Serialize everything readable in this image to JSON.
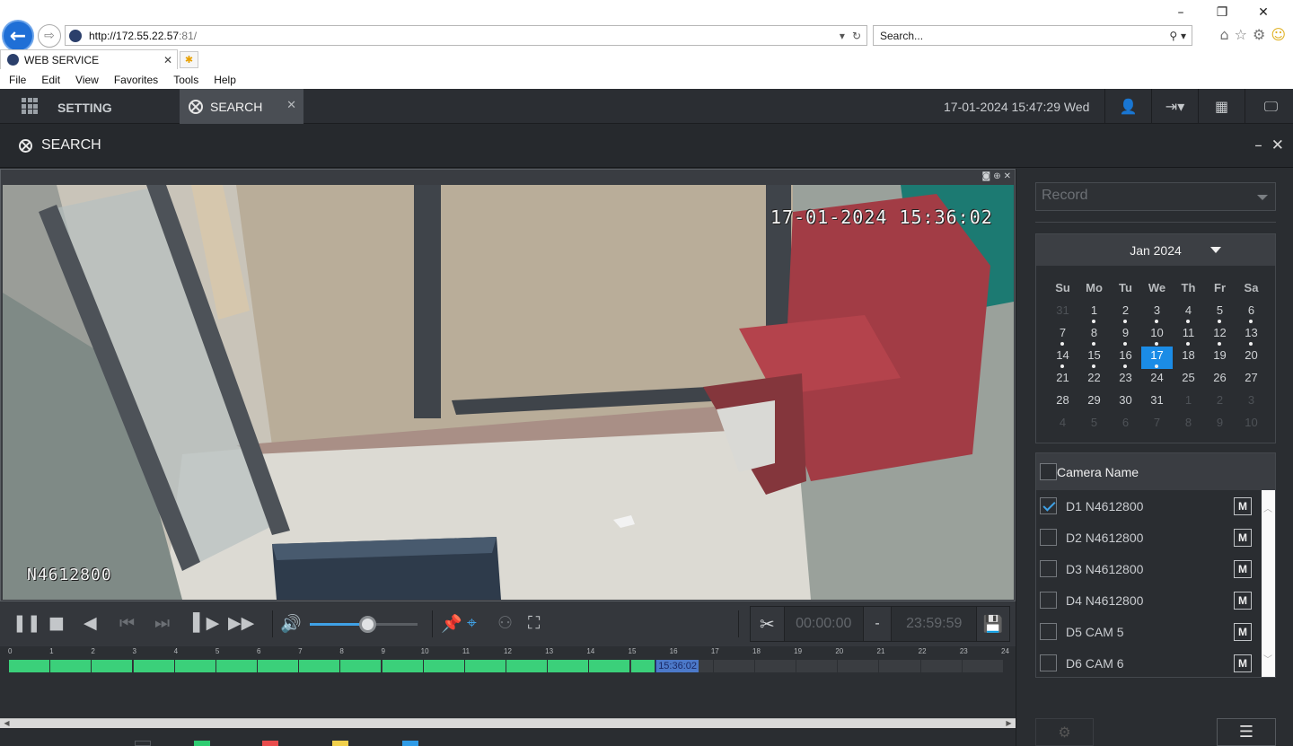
{
  "browser": {
    "window_controls": [
      "–",
      "❐",
      "✕"
    ],
    "url_host": "http://172.55.22.57",
    "url_port": ":81/",
    "search_placeholder": "Search...",
    "tab_title": "WEB SERVICE",
    "menu": [
      "File",
      "Edit",
      "View",
      "Favorites",
      "Tools",
      "Help"
    ]
  },
  "app": {
    "setting_tab": "SETTING",
    "search_tab": "SEARCH",
    "datetime": "17-01-2024 15:47:29 Wed",
    "page_title": "SEARCH"
  },
  "video": {
    "timestamp": "17-01-2024 15:36:02",
    "camera_overlay": "N4612800"
  },
  "playback": {
    "volume_fraction": 0.53,
    "clip_start": "00:00:00",
    "clip_separator": "-",
    "clip_end": "23:59:59"
  },
  "timeline": {
    "hours": [
      "0",
      "1",
      "2",
      "3",
      "4",
      "5",
      "6",
      "7",
      "8",
      "9",
      "10",
      "11",
      "12",
      "13",
      "14",
      "15",
      "16",
      "17",
      "18",
      "19",
      "20",
      "21",
      "22",
      "23",
      "24"
    ],
    "recorded_until_hour": 15.6,
    "cursor_label": "15:36:02",
    "cursor_hour": 15.6,
    "record_color": "#3bd07a",
    "legend_colors": [
      "#2b2e32",
      "#2ecc71",
      "#e84c4c",
      "#f1d04b",
      "#2f9be6"
    ]
  },
  "side": {
    "record_type": "Record",
    "calendar": {
      "month_label": "Jan 2024",
      "weekdays": [
        "Su",
        "Mo",
        "Tu",
        "We",
        "Th",
        "Fr",
        "Sa"
      ],
      "weeks": [
        [
          {
            "d": "31",
            "o": true
          },
          {
            "d": "1",
            "r": true
          },
          {
            "d": "2",
            "r": true
          },
          {
            "d": "3",
            "r": true
          },
          {
            "d": "4",
            "r": true
          },
          {
            "d": "5",
            "r": true
          },
          {
            "d": "6",
            "r": true
          }
        ],
        [
          {
            "d": "7",
            "r": true
          },
          {
            "d": "8",
            "r": true
          },
          {
            "d": "9",
            "r": true
          },
          {
            "d": "10",
            "r": true
          },
          {
            "d": "11",
            "r": true
          },
          {
            "d": "12",
            "r": true
          },
          {
            "d": "13",
            "r": true
          }
        ],
        [
          {
            "d": "14",
            "r": true
          },
          {
            "d": "15",
            "r": true
          },
          {
            "d": "16",
            "r": true
          },
          {
            "d": "17",
            "r": true,
            "s": true
          },
          {
            "d": "18"
          },
          {
            "d": "19"
          },
          {
            "d": "20"
          }
        ],
        [
          {
            "d": "21"
          },
          {
            "d": "22"
          },
          {
            "d": "23"
          },
          {
            "d": "24"
          },
          {
            "d": "25"
          },
          {
            "d": "26"
          },
          {
            "d": "27"
          }
        ],
        [
          {
            "d": "28"
          },
          {
            "d": "29"
          },
          {
            "d": "30"
          },
          {
            "d": "31"
          },
          {
            "d": "1",
            "o": true
          },
          {
            "d": "2",
            "o": true
          },
          {
            "d": "3",
            "o": true
          }
        ],
        [
          {
            "d": "4",
            "o": true
          },
          {
            "d": "5",
            "o": true
          },
          {
            "d": "6",
            "o": true
          },
          {
            "d": "7",
            "o": true
          },
          {
            "d": "8",
            "o": true
          },
          {
            "d": "9",
            "o": true
          },
          {
            "d": "10",
            "o": true
          }
        ]
      ]
    },
    "camera_header": "Camera Name",
    "cameras": [
      {
        "name": "D1 N4612800",
        "checked": true
      },
      {
        "name": "D2 N4612800",
        "checked": false
      },
      {
        "name": "D3 N4612800",
        "checked": false
      },
      {
        "name": "D4 N4612800",
        "checked": false
      },
      {
        "name": "D5 CAM 5",
        "checked": false
      },
      {
        "name": "D6 CAM 6",
        "checked": false
      }
    ],
    "m_label": "M"
  }
}
